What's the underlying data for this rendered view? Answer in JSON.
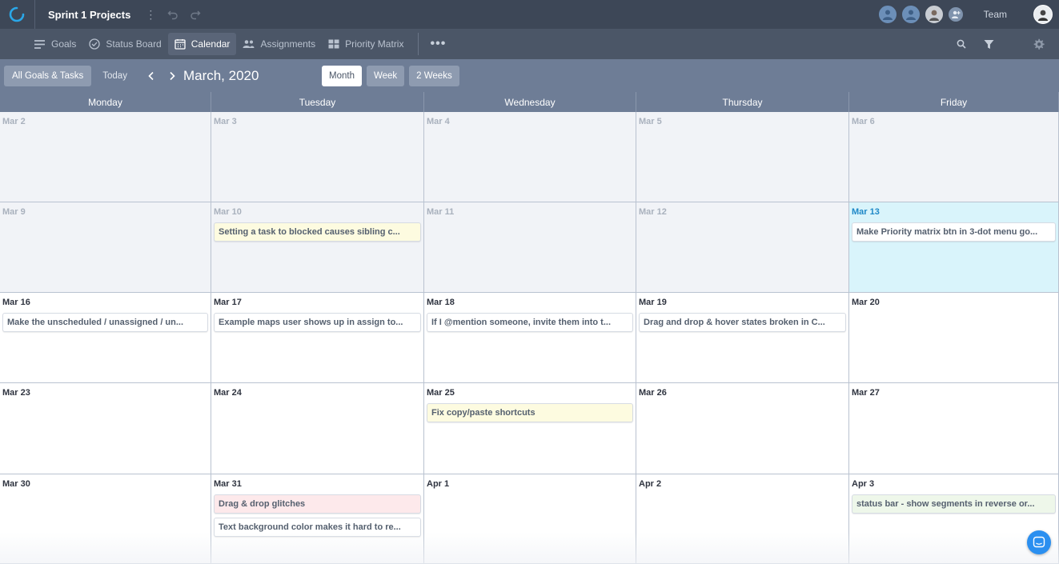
{
  "app": {
    "project_title": "Sprint 1 Projects",
    "team_label": "Team"
  },
  "nav": {
    "items": [
      {
        "label": "Goals",
        "icon": "goals-icon",
        "active": false
      },
      {
        "label": "Status Board",
        "icon": "status-board-icon",
        "active": false
      },
      {
        "label": "Calendar",
        "icon": "calendar-icon",
        "active": true
      },
      {
        "label": "Assignments",
        "icon": "assignments-icon",
        "active": false
      },
      {
        "label": "Priority Matrix",
        "icon": "priority-matrix-icon",
        "active": false
      }
    ],
    "more": "•••"
  },
  "toolbar": {
    "all_label": "All Goals & Tasks",
    "today_label": "Today",
    "month_title": "March, 2020",
    "views": [
      "Month",
      "Week",
      "2 Weeks"
    ],
    "active_view": "Month"
  },
  "days": [
    "Monday",
    "Tuesday",
    "Wednesday",
    "Thursday",
    "Friday"
  ],
  "weeks": [
    {
      "cells": [
        {
          "date": "Mar 2",
          "state": "past",
          "tasks": []
        },
        {
          "date": "Mar 3",
          "state": "past",
          "tasks": []
        },
        {
          "date": "Mar 4",
          "state": "past",
          "tasks": []
        },
        {
          "date": "Mar 5",
          "state": "past",
          "tasks": []
        },
        {
          "date": "Mar 6",
          "state": "past",
          "tasks": []
        }
      ]
    },
    {
      "cells": [
        {
          "date": "Mar 9",
          "state": "past",
          "tasks": []
        },
        {
          "date": "Mar 10",
          "state": "past",
          "tasks": [
            {
              "text": "Setting a task to blocked causes sibling c...",
              "color": "yellow"
            }
          ]
        },
        {
          "date": "Mar 11",
          "state": "past",
          "tasks": []
        },
        {
          "date": "Mar 12",
          "state": "past",
          "tasks": []
        },
        {
          "date": "Mar 13",
          "state": "today",
          "tasks": [
            {
              "text": "Make Priority matrix btn in 3-dot menu go...",
              "color": "white"
            }
          ]
        }
      ]
    },
    {
      "cells": [
        {
          "date": "Mar 16",
          "state": "future",
          "tasks": [
            {
              "text": "Make the unscheduled / unassigned / un...",
              "color": "white"
            }
          ]
        },
        {
          "date": "Mar 17",
          "state": "future",
          "tasks": [
            {
              "text": "Example maps user shows up in assign to...",
              "color": "white"
            }
          ]
        },
        {
          "date": "Mar 18",
          "state": "future",
          "tasks": [
            {
              "text": "If I @mention someone, invite them into t...",
              "color": "white"
            }
          ]
        },
        {
          "date": "Mar 19",
          "state": "future",
          "tasks": [
            {
              "text": "Drag and drop & hover states broken in C...",
              "color": "white"
            }
          ]
        },
        {
          "date": "Mar 20",
          "state": "future",
          "tasks": []
        }
      ]
    },
    {
      "cells": [
        {
          "date": "Mar 23",
          "state": "future",
          "tasks": []
        },
        {
          "date": "Mar 24",
          "state": "future",
          "tasks": []
        },
        {
          "date": "Mar 25",
          "state": "future",
          "tasks": [
            {
              "text": "Fix copy/paste shortcuts",
              "color": "yellow"
            }
          ]
        },
        {
          "date": "Mar 26",
          "state": "future",
          "tasks": []
        },
        {
          "date": "Mar 27",
          "state": "future",
          "tasks": []
        }
      ]
    },
    {
      "cells": [
        {
          "date": "Mar 30",
          "state": "future",
          "tasks": []
        },
        {
          "date": "Mar 31",
          "state": "future",
          "tasks": [
            {
              "text": "Drag & drop glitches",
              "color": "pink"
            },
            {
              "text": "Text background color makes it hard to re...",
              "color": "white"
            }
          ]
        },
        {
          "date": "Apr 1",
          "state": "future",
          "tasks": []
        },
        {
          "date": "Apr 2",
          "state": "future",
          "tasks": []
        },
        {
          "date": "Apr 3",
          "state": "future",
          "tasks": [
            {
              "text": "status bar - show segments in reverse or...",
              "color": "green"
            }
          ]
        }
      ]
    }
  ],
  "colors": {
    "topbar": "#3d4757",
    "navbar": "#4b5667",
    "toolbar": "#6e7d96",
    "today_cell": "#d9f4fb",
    "accent": "#2a8ff0"
  }
}
